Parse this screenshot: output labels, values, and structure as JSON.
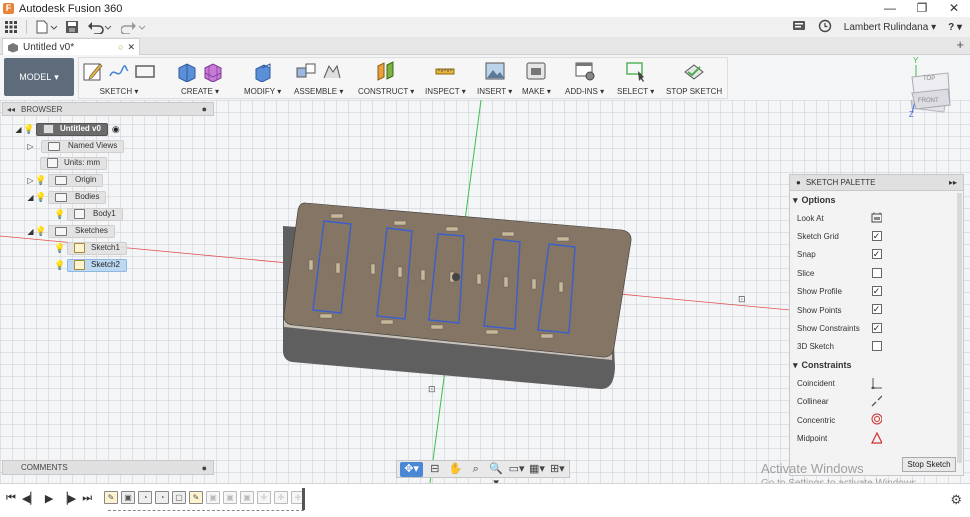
{
  "window": {
    "title": "Autodesk Fusion 360",
    "minimize": "—",
    "maximize": "❐",
    "close": "✕"
  },
  "qat": {
    "user": "Lambert Rulindana ▾",
    "help": "? ▾"
  },
  "document_tab": {
    "label": "Untitled v0*",
    "close": "✕",
    "add": "+"
  },
  "toolbar": {
    "workspace": "MODEL",
    "groups": [
      {
        "label": "SKETCH ▾"
      },
      {
        "label": "CREATE ▾"
      },
      {
        "label": "MODIFY ▾"
      },
      {
        "label": "ASSEMBLE ▾"
      },
      {
        "label": "CONSTRUCT ▾"
      },
      {
        "label": "INSPECT ▾"
      },
      {
        "label": "INSERT ▾"
      },
      {
        "label": "MAKE ▾"
      },
      {
        "label": "ADD-INS ▾"
      },
      {
        "label": "SELECT ▾"
      },
      {
        "label": "STOP SKETCH"
      }
    ]
  },
  "browser": {
    "title": "BROWSER",
    "items": [
      {
        "label": "Untitled v0"
      },
      {
        "label": "Named Views"
      },
      {
        "label": "Units: mm"
      },
      {
        "label": "Origin"
      },
      {
        "label": "Bodies"
      },
      {
        "label": "Body1"
      },
      {
        "label": "Sketches"
      },
      {
        "label": "Sketch1"
      },
      {
        "label": "Sketch2"
      }
    ]
  },
  "viewcube": {
    "top": "TOP",
    "front": "FRONT",
    "axis_y": "Y",
    "axis_z": "Z"
  },
  "palette": {
    "title": "SKETCH PALETTE",
    "options_header": "Options",
    "options": [
      {
        "label": "Look At",
        "control": "icon"
      },
      {
        "label": "Sketch Grid",
        "control": "checked"
      },
      {
        "label": "Snap",
        "control": "checked"
      },
      {
        "label": "Slice",
        "control": "unchecked"
      },
      {
        "label": "Show Profile",
        "control": "checked"
      },
      {
        "label": "Show Points",
        "control": "checked"
      },
      {
        "label": "Show Constraints",
        "control": "checked"
      },
      {
        "label": "3D Sketch",
        "control": "unchecked"
      }
    ],
    "constraints_header": "Constraints",
    "constraints": [
      {
        "label": "Coincident",
        "icon": "coincident-icon"
      },
      {
        "label": "Collinear",
        "icon": "collinear-icon"
      },
      {
        "label": "Concentric",
        "icon": "concentric-icon"
      },
      {
        "label": "Midpoint",
        "icon": "midpoint-icon"
      }
    ],
    "stop_sketch": "Stop Sketch"
  },
  "comments": {
    "title": "COMMENTS"
  },
  "activate_windows": {
    "line1": "Activate Windows",
    "line2": "Go to Settings to activate Windows."
  },
  "colors": {
    "accent": "#4a87d4",
    "body_fill": "#857565",
    "body_side": "#5f5f5f",
    "sketch_line": "#3a5fcd",
    "axis_red": "#e05050",
    "axis_green": "#3cc050"
  }
}
